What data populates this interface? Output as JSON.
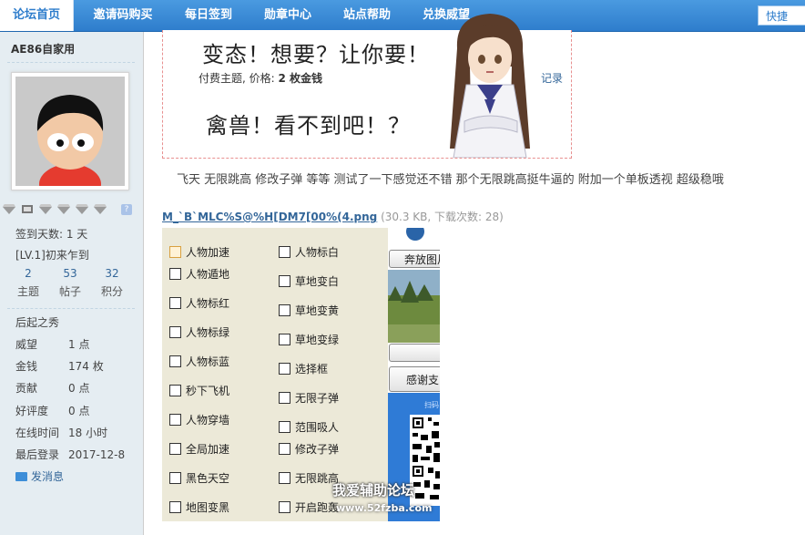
{
  "nav": {
    "tabs": [
      "论坛首页",
      "邀请码购买",
      "每日签到",
      "勋章中心",
      "站点帮助",
      "兑换威望"
    ],
    "quick": "快捷"
  },
  "sidebar": {
    "username": "AE86自家用",
    "help": "?",
    "checkin": "签到天数: 1 天",
    "level": "[LV.1]初来乍到",
    "stats": [
      {
        "num": "2",
        "label": "主题"
      },
      {
        "num": "53",
        "label": "帖子"
      },
      {
        "num": "32",
        "label": "积分"
      }
    ],
    "rank": "后起之秀",
    "details": [
      {
        "k": "威望",
        "v": "1 点"
      },
      {
        "k": "金钱",
        "v": "174 枚"
      },
      {
        "k": "贡献",
        "v": "0 点"
      },
      {
        "k": "好评度",
        "v": "0 点"
      },
      {
        "k": "在线时间",
        "v": "18 小时"
      },
      {
        "k": "最后登录",
        "v": "2017-12-8"
      }
    ],
    "send_msg": "发消息"
  },
  "post": {
    "hw_line1": "变态！想要？让你要！",
    "hw_line2": "禽兽！看不到吧！？",
    "paid_prefix": "付费主题, 价格: ",
    "paid_price": "2 枚金钱",
    "record": "记录",
    "body": "飞天 无限跳高 修改子弹 等等 测试了一下感觉还不错 那个无限跳高挺牛逼的 附加一个单板透视 超级稳哦",
    "attachment_name": "M_`B`MLC%S@%H[DM7[00%(4.png",
    "attachment_meta": " (30.3 KB, 下载次数: 28)"
  },
  "cheat_left": [
    "人物加速",
    "人物遁地",
    "人物标红",
    "人物标绿",
    "人物标蓝",
    "秒下飞机",
    "人物穿墙",
    "全局加速",
    "黑色天空",
    "地图变黑"
  ],
  "cheat_right": [
    "人物标白",
    "草地变白",
    "草地变黄",
    "草地变绿",
    "选择框",
    "无限子弹",
    "范围吸人",
    "修改子弹",
    "无限跳高",
    "开启跑轰"
  ],
  "mini": {
    "btn1": "奔放图片",
    "btn2": "感谢支",
    "scan": "扫码"
  },
  "watermark": "我爱辅助论坛",
  "watermark_url": "www.52fzba.com"
}
